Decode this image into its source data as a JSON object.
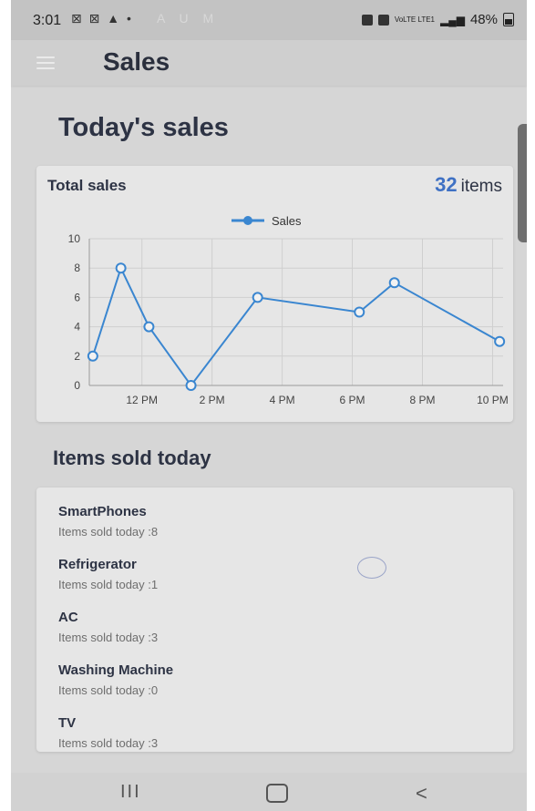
{
  "status_bar": {
    "time": "3:01",
    "left_icons": "⊠ ⊠ ▲ •",
    "faded_icons": "A U M",
    "network": "VoLTE LTE1",
    "battery": "48%"
  },
  "appbar": {
    "title": "Sales"
  },
  "page": {
    "heading": "Today's sales"
  },
  "sales_card": {
    "title": "Total sales",
    "total_value": "32",
    "total_unit": "items"
  },
  "chart_data": {
    "type": "line",
    "legend": "Sales",
    "x_labels": [
      "12 PM",
      "2 PM",
      "4 PM",
      "6 PM",
      "8 PM",
      "10 PM"
    ],
    "x_hours": [
      10.6,
      11.4,
      12.2,
      13.4,
      15.3,
      18.2,
      19.2,
      22.2
    ],
    "values": [
      2,
      8,
      4,
      0,
      6,
      5,
      7,
      3
    ],
    "ylim": [
      0,
      10
    ],
    "yticks": [
      0,
      2,
      4,
      6,
      8,
      10
    ],
    "grid": true,
    "color": "#3a86d0"
  },
  "items_section": {
    "heading": "Items sold today"
  },
  "items": [
    {
      "name": "SmartPhones",
      "detail": "Items sold today :8"
    },
    {
      "name": "Refrigerator",
      "detail": "Items sold today :1"
    },
    {
      "name": "AC",
      "detail": "Items sold today :3"
    },
    {
      "name": "Washing Machine",
      "detail": "Items sold today :0"
    },
    {
      "name": "TV",
      "detail": "Items sold today :3"
    }
  ],
  "navbar": {
    "recent": "III",
    "back": "<"
  }
}
